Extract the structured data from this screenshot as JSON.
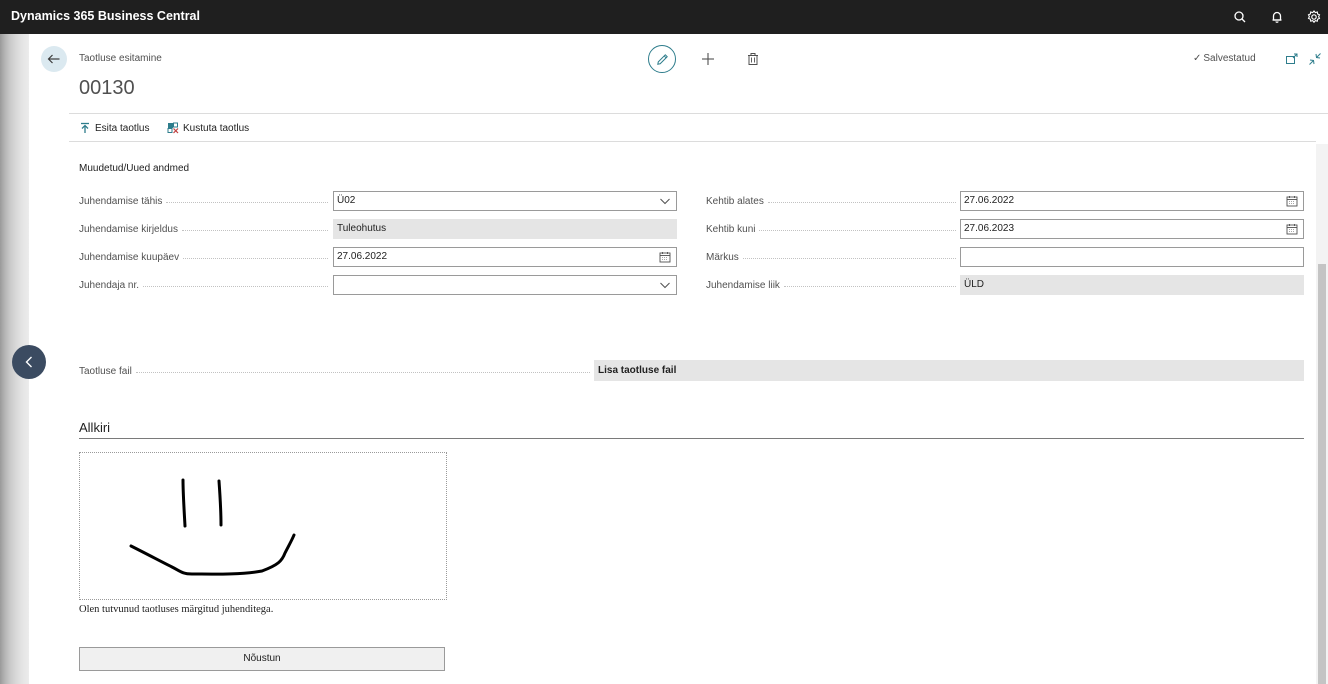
{
  "app": {
    "title": "Dynamics 365 Business Central"
  },
  "topbar_icons": [
    "search-icon",
    "bell-icon",
    "gear-icon"
  ],
  "header": {
    "caption": "Taotluse esitamine",
    "record_no": "00130",
    "saved_label": "Salvestatud"
  },
  "actions": [
    {
      "label": "Esita taotlus",
      "icon": "submit-icon"
    },
    {
      "label": "Kustuta taotlus",
      "icon": "delete-request-icon"
    }
  ],
  "section": {
    "title": "Muudetud/Uued andmed"
  },
  "left_fields": [
    {
      "label": "Juhendamise tähis",
      "value": "Ü02",
      "kind": "dropdown"
    },
    {
      "label": "Juhendamise kirjeldus",
      "value": "Tuleohutus",
      "kind": "readonly"
    },
    {
      "label": "Juhendamise kuupäev",
      "value": "27.06.2022",
      "kind": "date"
    },
    {
      "label": "Juhendaja nr.",
      "value": "",
      "kind": "dropdown"
    }
  ],
  "right_fields": [
    {
      "label": "Kehtib alates",
      "value": "27.06.2022",
      "kind": "date"
    },
    {
      "label": "Kehtib kuni",
      "value": "27.06.2023",
      "kind": "date"
    },
    {
      "label": "Märkus",
      "value": "",
      "kind": "text"
    },
    {
      "label": "Juhendamise liik",
      "value": "ÜLD",
      "kind": "readonly"
    }
  ],
  "file": {
    "label": "Taotluse fail",
    "action": "Lisa taotluse fail"
  },
  "signature": {
    "title": "Allkiri",
    "agreement_text": "Olen tutvunud taotluses märgitud juhenditega.",
    "agree_button": "Nõustun"
  },
  "colors": {
    "topbar": "#1f1f1f",
    "accent": "#2e7d8c",
    "readonly_bg": "#e5e5e5"
  }
}
